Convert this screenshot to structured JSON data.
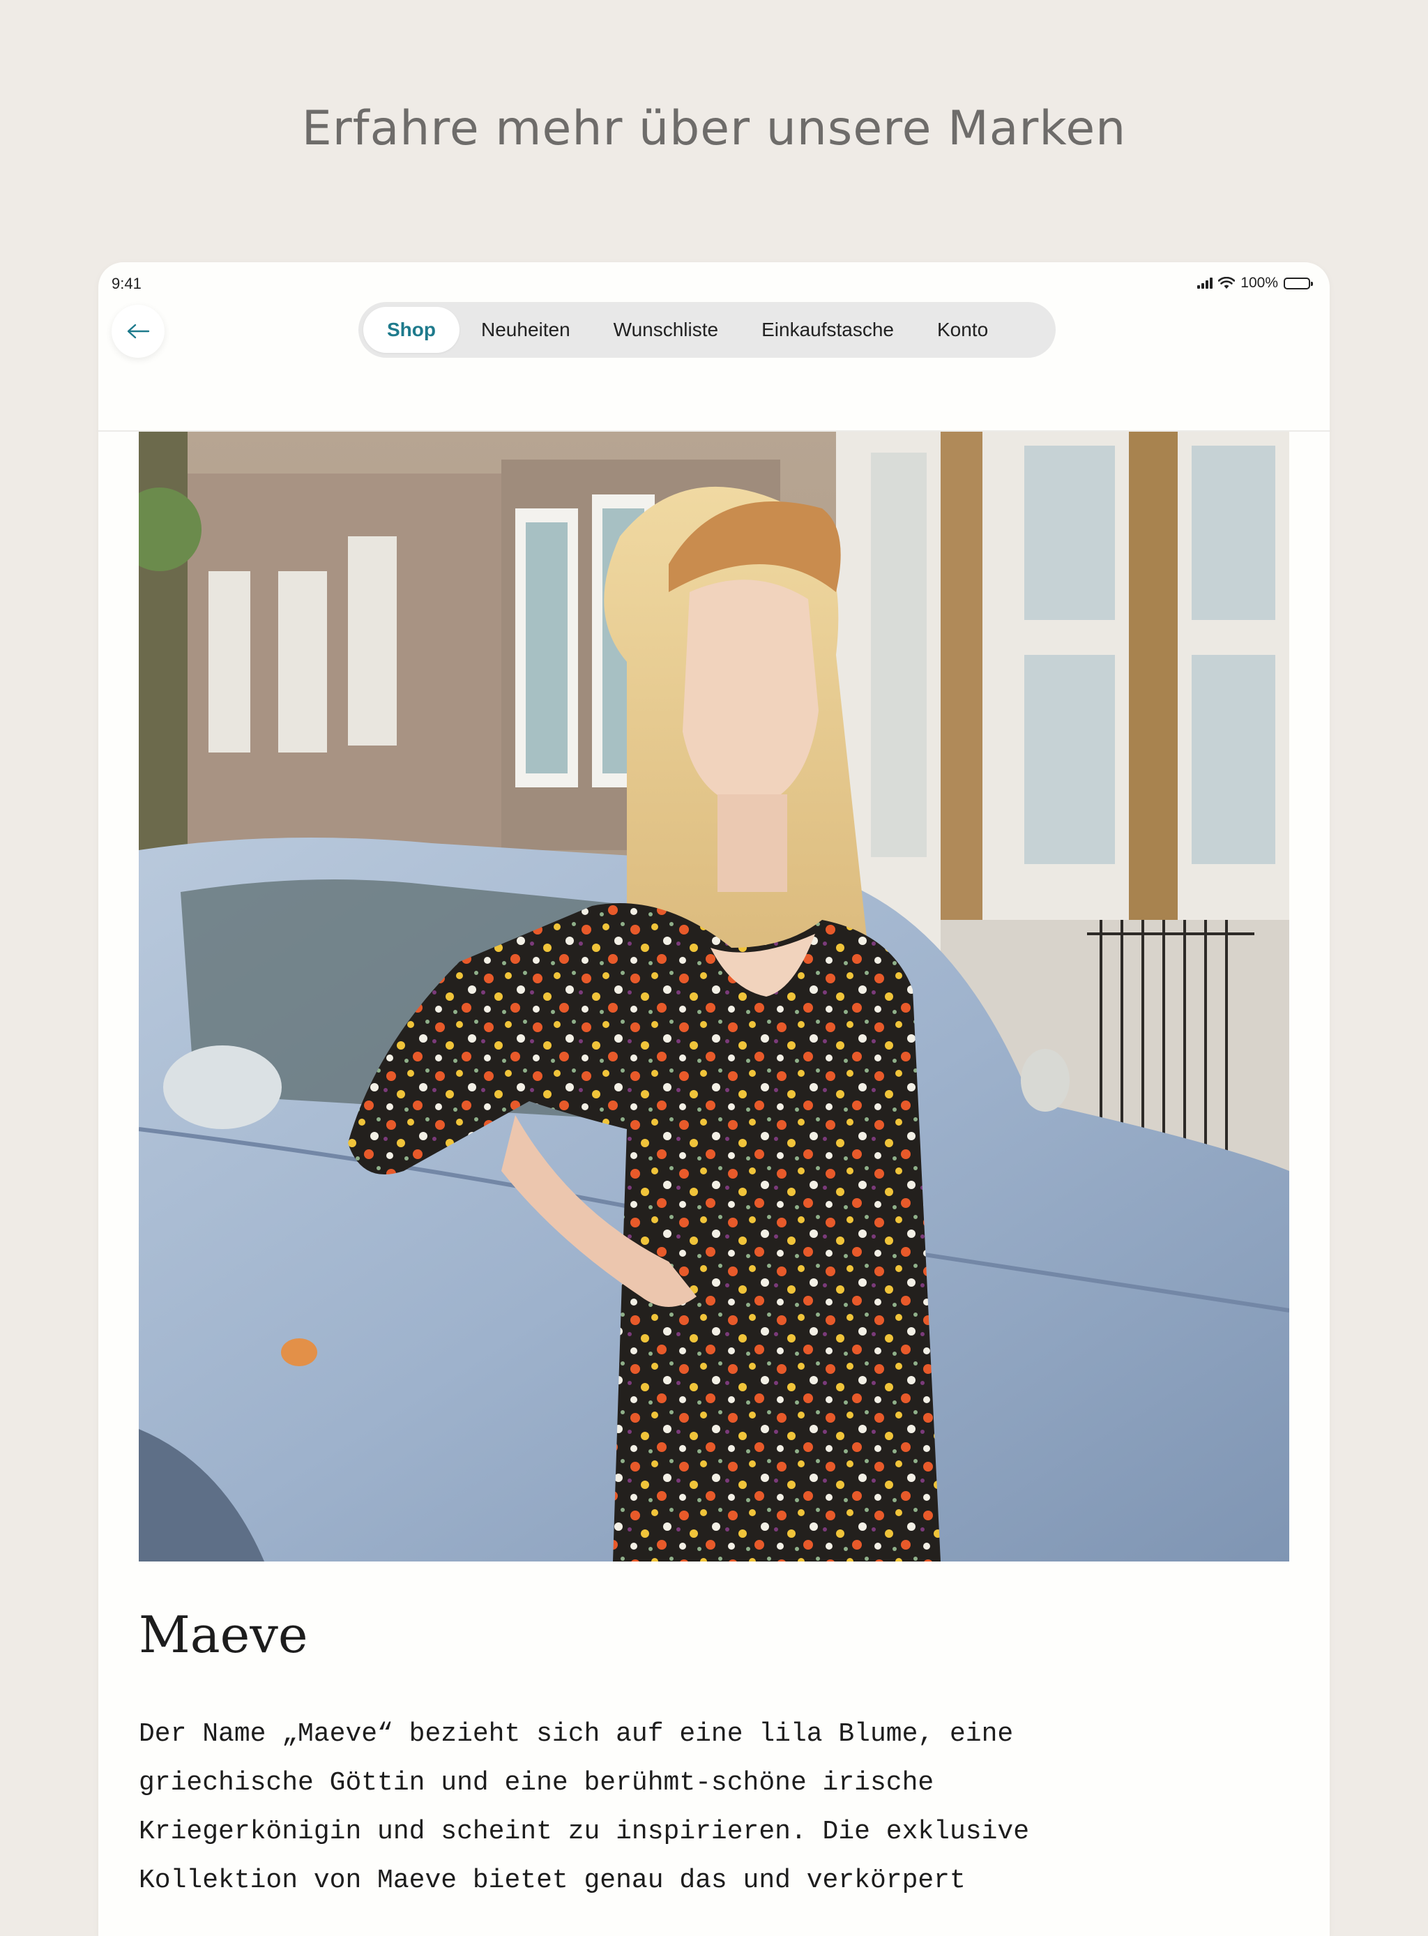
{
  "page": {
    "headline": "Erfahre mehr über unsere Marken"
  },
  "status_bar": {
    "time": "9:41",
    "battery": "100%"
  },
  "nav": {
    "back_icon": "arrow-left-icon",
    "tabs": [
      {
        "label": "Shop",
        "active": true
      },
      {
        "label": "Neuheiten",
        "active": false
      },
      {
        "label": "Wunschliste",
        "active": false
      },
      {
        "label": "Einkaufstasche",
        "active": false
      },
      {
        "label": "Konto",
        "active": false
      }
    ],
    "accent_color": "#1e7a8c"
  },
  "brand": {
    "name": "Maeve",
    "description": "Der Name „Maeve“ bezieht sich auf eine lila Blume, eine\ngriechische Göttin und eine berühmt-schöne irische\nKriegerkönigin und scheint zu inspirieren. Die exklusive\nKollektion von Maeve bietet genau das und verkörpert"
  }
}
